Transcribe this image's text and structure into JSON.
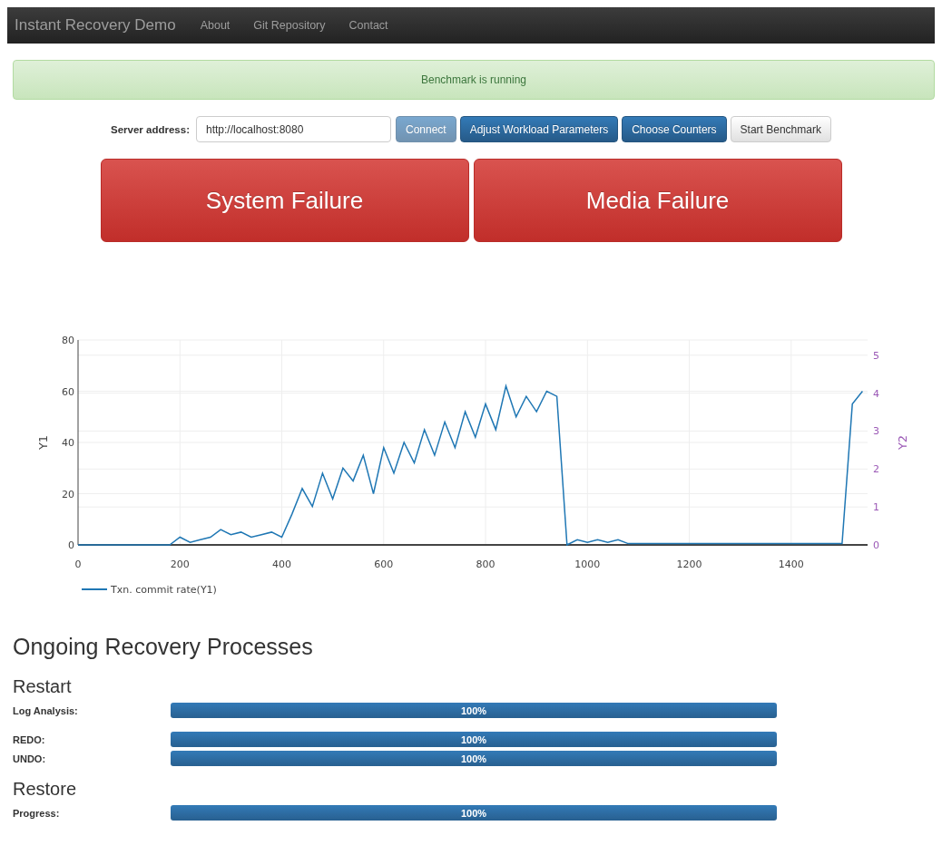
{
  "navbar": {
    "brand": "Instant Recovery Demo",
    "links": [
      {
        "label": "About"
      },
      {
        "label": "Git Repository"
      },
      {
        "label": "Contact"
      }
    ]
  },
  "alert": {
    "message": "Benchmark is running"
  },
  "server": {
    "label": "Server address:",
    "value": "http://localhost:8080",
    "buttons": [
      {
        "label": "Connect",
        "kind": "primary",
        "disabled": true
      },
      {
        "label": "Adjust Workload Parameters",
        "kind": "primary",
        "disabled": false
      },
      {
        "label": "Choose Counters",
        "kind": "primary",
        "disabled": false
      },
      {
        "label": "Start Benchmark",
        "kind": "default",
        "disabled": false
      }
    ]
  },
  "failure_buttons": [
    {
      "label": "System Failure"
    },
    {
      "label": "Media Failure"
    }
  ],
  "chart": {
    "chart_data": {
      "type": "line",
      "ylabel": "Y1",
      "y2label": "Y2",
      "xlim": [
        0,
        1550
      ],
      "ylim": [
        0,
        80
      ],
      "xticks": [
        0,
        200,
        400,
        600,
        800,
        1000,
        1200,
        1400
      ],
      "yticks": [
        0,
        20,
        40,
        60,
        80
      ],
      "y2ticks": [
        0,
        1,
        2,
        3,
        4,
        5
      ],
      "y2lim": [
        0,
        5.4
      ],
      "grid": true,
      "x": [
        0,
        20,
        40,
        60,
        80,
        100,
        120,
        140,
        160,
        180,
        200,
        220,
        240,
        260,
        280,
        300,
        320,
        340,
        360,
        380,
        400,
        420,
        440,
        460,
        480,
        500,
        520,
        540,
        560,
        580,
        600,
        620,
        640,
        660,
        680,
        700,
        720,
        740,
        760,
        780,
        800,
        820,
        840,
        860,
        880,
        900,
        920,
        940,
        960,
        980,
        1000,
        1020,
        1040,
        1060,
        1080,
        1100,
        1120,
        1140,
        1160,
        1180,
        1200,
        1220,
        1240,
        1260,
        1280,
        1300,
        1320,
        1340,
        1360,
        1380,
        1400,
        1420,
        1440,
        1460,
        1480,
        1500,
        1520,
        1540
      ],
      "series": [
        {
          "name": "Txn. commit rate(Y1)",
          "color": "#1f77b4",
          "values": [
            0,
            0,
            0,
            0,
            0,
            0,
            0,
            0,
            0,
            0,
            3,
            1,
            2,
            3,
            6,
            4,
            5,
            3,
            4,
            5,
            3,
            12,
            22,
            15,
            28,
            18,
            30,
            25,
            35,
            20,
            38,
            28,
            40,
            32,
            45,
            35,
            48,
            38,
            52,
            42,
            55,
            45,
            62,
            50,
            58,
            52,
            60,
            58,
            0,
            2,
            1,
            2,
            1,
            2,
            0.5,
            0.5,
            0.5,
            0.5,
            0.5,
            0.5,
            0.5,
            0.5,
            0.5,
            0.5,
            0.5,
            0.5,
            0.5,
            0.5,
            0.5,
            0.5,
            0.5,
            0.5,
            0.5,
            0.5,
            0.5,
            0.5,
            55,
            60
          ]
        }
      ]
    }
  },
  "recovery": {
    "title": "Ongoing Recovery Processes",
    "sections": [
      {
        "title": "Restart",
        "items": [
          {
            "label": "Log Analysis:",
            "level": 1,
            "reading": "100%"
          },
          {
            "label": "REDO:",
            "level": 1,
            "reading": "100%"
          },
          {
            "label": "UNDO:",
            "level": 1,
            "reading": "100%"
          }
        ]
      },
      {
        "title": "Restore",
        "items": [
          {
            "label": "Progress:",
            "level": 1,
            "reading": "100%"
          }
        ]
      }
    ]
  }
}
